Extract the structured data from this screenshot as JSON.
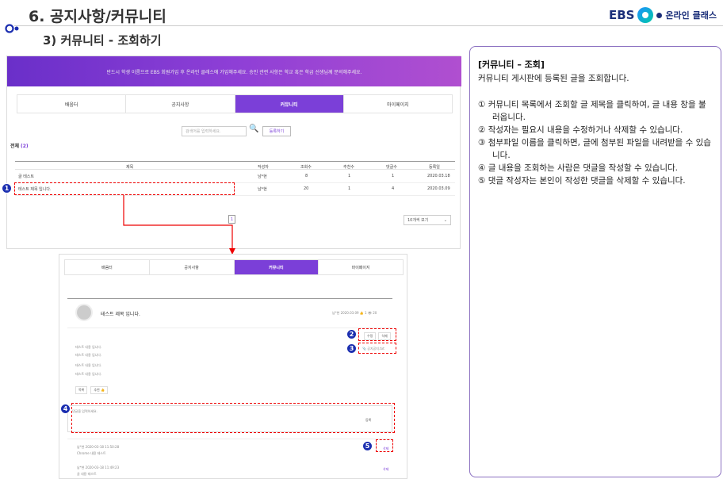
{
  "header": {
    "title": "6. 공지사항/커뮤니티",
    "subtitle": "3) 커뮤니티 - 조회하기"
  },
  "brand": {
    "name": "EBS",
    "service": "온라인 클래스"
  },
  "list_screen": {
    "banner_text": "반드시 학생 이름으로 EBS 회원가입 후 온라인 클래스에 가입해주세요. 승인 관련 사항은 학교 혹은 학급 선생님께 문의해주세요.",
    "tabs": [
      "배움터",
      "공지사항",
      "커뮤니티",
      "마이페이지"
    ],
    "active_tab": "커뮤니티",
    "search_placeholder": "검색어를 입력하세요.",
    "register_label": "등록하기",
    "total_label": "전체",
    "total_count": "(2)",
    "columns": [
      "제목",
      "작성자",
      "조회수",
      "추천수",
      "댓글수",
      "등록일"
    ],
    "rows": [
      [
        "글 테스트",
        "남*현",
        "8",
        "1",
        "1",
        "2020.03.18"
      ],
      [
        "테스트 제목 입니다.",
        "남*현",
        "20",
        "1",
        "4",
        "2020.03.09"
      ]
    ],
    "page": "1",
    "view_select": "10개씩 보기"
  },
  "detail_screen": {
    "tabs": [
      "배움터",
      "공지사항",
      "커뮤니티",
      "마이페이지"
    ],
    "post_title": "테스트 제목 입니다.",
    "post_meta": "남*현   2020.03.09   👍 1   👁 20",
    "edit_label": "수정",
    "delete_label": "삭제",
    "attachment_label": "공지공지.txt",
    "body_lines": [
      "테스트 내용 입니다.",
      "테스트 내용 입니다.",
      "테스트 내용 입니다.",
      "테스트 내용 입니다."
    ],
    "list_btn": "목록",
    "recommend_btn": "추천 👍",
    "comment_placeholder": "댓글을 입력하세요.",
    "comment_register": "등록",
    "comments": [
      {
        "author": "남*현",
        "date": "2020-03-18 11:50:28",
        "text": "Chrome 내용 테스트",
        "action": "삭제"
      },
      {
        "author": "남*현",
        "date": "2020-03-18 11:49:23",
        "text": "글 내용 테스트",
        "action": "삭제"
      }
    ]
  },
  "badges": [
    "1",
    "2",
    "3",
    "4",
    "5"
  ],
  "panel": {
    "title": "[커뮤니티 – 조회]",
    "desc": "커뮤니티 게시판에 등록된 글을 조회합니다.",
    "items": [
      "① 커뮤니티 목록에서 조회할 글 제목을 클릭하여, 글 내용 창을 불러옵니다.",
      "② 작성자는 필요시 내용을 수정하거나 삭제할 수 있습니다.",
      "③ 첨부파일 이름을 클릭하면, 글에 첨부된 파일을 내려받을 수 있습니다.",
      "④ 글 내용을 조회하는 사람은 댓글을 작성할 수 있습니다.",
      "⑤ 댓글 작성자는 본인이 작성한 댓글을 삭제할 수 있습니다."
    ]
  },
  "colors": {
    "accent": "#7b3fd8",
    "highlight": "#e00000",
    "badge": "#1c2fb0",
    "panel_border": "#8a6fc0"
  }
}
